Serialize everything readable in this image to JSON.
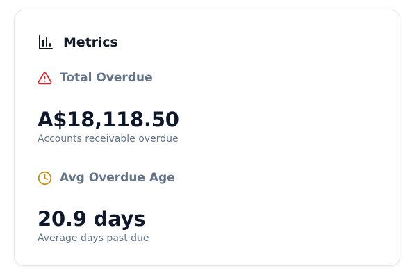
{
  "card": {
    "title": "Metrics",
    "title_icon": "bar-chart-icon"
  },
  "metrics": [
    {
      "label": "Total Overdue",
      "icon": "warning-triangle-icon",
      "icon_color": "#dc2626",
      "value": "A$18,118.50",
      "subtitle": "Accounts receivable overdue"
    },
    {
      "label": "Avg Overdue Age",
      "icon": "clock-icon",
      "icon_color": "#ca8a04",
      "value": "20.9 days",
      "subtitle": "Average days past due"
    }
  ],
  "colors": {
    "label": "#64748b",
    "value": "#0f172a",
    "border": "#e5e7eb"
  }
}
